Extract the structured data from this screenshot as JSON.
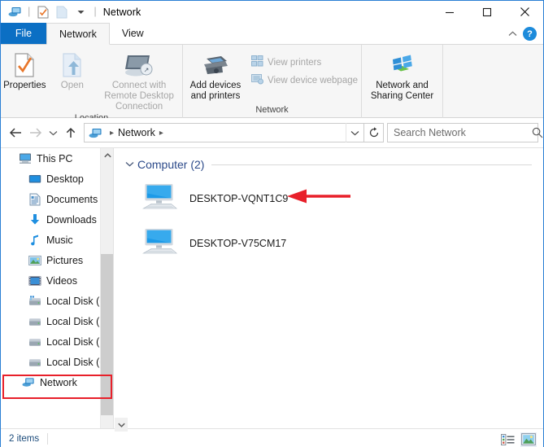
{
  "window": {
    "title": "Network",
    "quick_access": [
      "window-icon",
      "properties-icon",
      "new-folder-icon",
      "customize-dropdown"
    ],
    "controls": {
      "minimize": "–",
      "maximize": "□",
      "close": "✕"
    }
  },
  "tabs": [
    {
      "label": "File",
      "state": "file-menu"
    },
    {
      "label": "Network",
      "state": "active"
    },
    {
      "label": "View",
      "state": "inactive"
    }
  ],
  "tabstrip_right": {
    "collapse_ribbon": "^",
    "help": "?"
  },
  "ribbon": {
    "groups": [
      {
        "title": "Location",
        "buttons": [
          {
            "label": "Properties",
            "icon": "properties-icon",
            "enabled": true
          },
          {
            "label": "Open",
            "icon": "open-icon",
            "enabled": false
          },
          {
            "label": "Connect with Remote Desktop Connection",
            "icon": "remote-desktop-icon",
            "enabled": false
          }
        ]
      },
      {
        "title": "Network",
        "buttons": [
          {
            "label": "Add devices and printers",
            "icon": "printer-icon",
            "enabled": true
          },
          {
            "label": "View printers",
            "icon": "view-printers-icon",
            "enabled": false
          },
          {
            "label": "View device webpage",
            "icon": "view-webpage-icon",
            "enabled": false
          }
        ]
      },
      {
        "title": "",
        "buttons": [
          {
            "label": "Network and Sharing Center",
            "icon": "network-sharing-icon",
            "enabled": true
          }
        ]
      }
    ]
  },
  "addressbar": {
    "back": "back-arrow",
    "forward": "forward-arrow",
    "recent": "recent-dropdown",
    "up": "up-arrow",
    "breadcrumb": {
      "icon": "network-icon",
      "path": "Network"
    },
    "dropdown": "v",
    "refresh": "refresh-icon"
  },
  "search": {
    "placeholder": "Search Network",
    "value": "",
    "icon": "search-icon"
  },
  "sidebar": {
    "items": [
      {
        "label": "This PC",
        "icon": "this-pc-icon",
        "level": 0,
        "highlighted": false
      },
      {
        "label": "Desktop",
        "icon": "desktop-icon",
        "level": 1,
        "highlighted": false
      },
      {
        "label": "Documents",
        "icon": "documents-icon",
        "level": 1,
        "highlighted": false
      },
      {
        "label": "Downloads",
        "icon": "downloads-icon",
        "level": 1,
        "highlighted": false
      },
      {
        "label": "Music",
        "icon": "music-icon",
        "level": 1,
        "highlighted": false
      },
      {
        "label": "Pictures",
        "icon": "pictures-icon",
        "level": 1,
        "highlighted": false
      },
      {
        "label": "Videos",
        "icon": "videos-icon",
        "level": 1,
        "highlighted": false
      },
      {
        "label": "Local Disk (C:)",
        "icon": "system-drive-icon",
        "level": 1,
        "highlighted": false
      },
      {
        "label": "Local Disk (E:)",
        "icon": "drive-icon",
        "level": 1,
        "highlighted": false
      },
      {
        "label": "Local Disk (F:)",
        "icon": "drive-icon",
        "level": 1,
        "highlighted": false
      },
      {
        "label": "Local Disk (G:)",
        "icon": "drive-icon",
        "level": 1,
        "highlighted": false
      },
      {
        "label": "Network",
        "icon": "network-icon",
        "level": 0,
        "highlighted": true
      }
    ]
  },
  "content": {
    "group": {
      "label": "Computer (2)",
      "expanded": true
    },
    "items": [
      {
        "label": "DESKTOP-VQNT1C9",
        "icon": "computer-icon",
        "annotated": true
      },
      {
        "label": "DESKTOP-V75CM17",
        "icon": "computer-icon",
        "annotated": false
      }
    ]
  },
  "statusbar": {
    "count": "2 items",
    "view_buttons": [
      {
        "name": "details-view",
        "active": false
      },
      {
        "name": "large-icons-view",
        "active": true
      }
    ]
  },
  "annotations": {
    "arrow_color": "#e8202a",
    "box_color": "#e8202a",
    "arrow_target": "DESKTOP-VQNT1C9",
    "box_target": "Network"
  }
}
